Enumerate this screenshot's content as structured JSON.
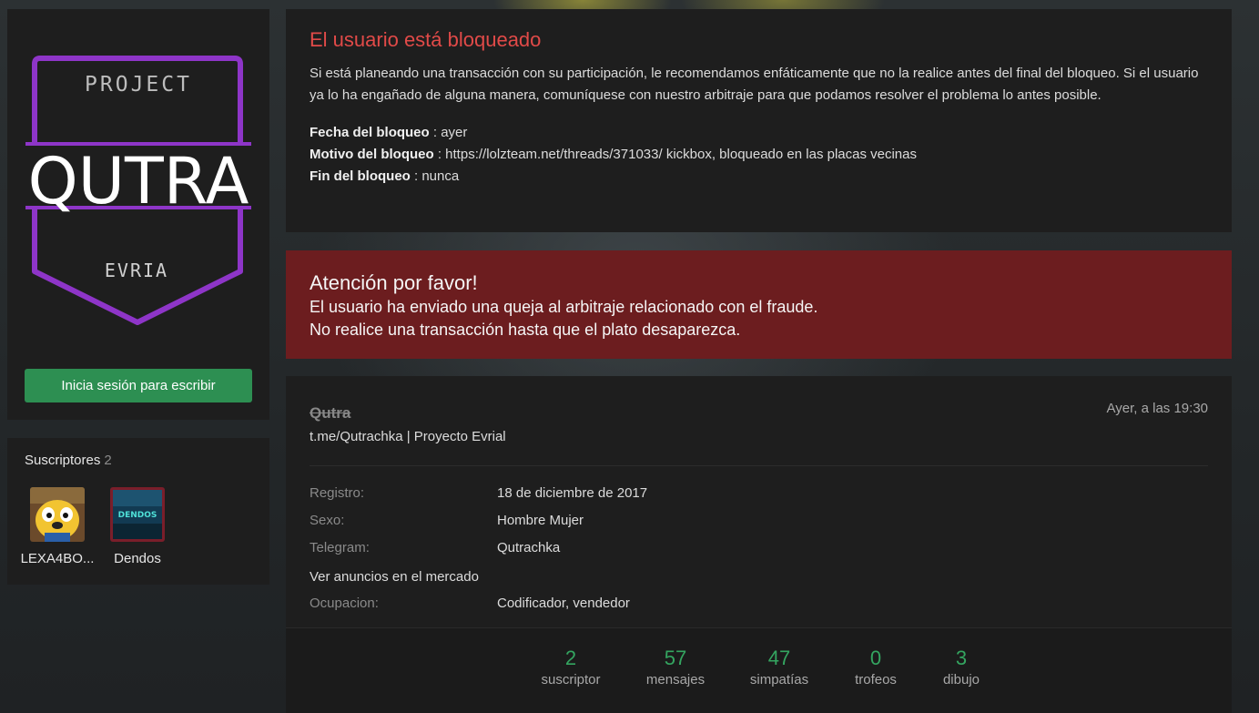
{
  "sidebar": {
    "login_button": "Inicia sesión para escribir",
    "logo": {
      "top_text": "PROJECT",
      "main_text": "QUTRA",
      "bottom_text": "EVRIA",
      "accent_color": "#8e35c8"
    },
    "subscribers": {
      "title": "Suscriptores",
      "count": "2",
      "items": [
        {
          "name": "LEXA4BO...",
          "avatar": "cartoon-dog-avatar"
        },
        {
          "name": "Dendos",
          "avatar": "dendos-avatar"
        }
      ]
    }
  },
  "blocked": {
    "title": "El usuario está bloqueado",
    "description": "Si está planeando una transacción con su participación, le recomendamos enfáticamente que no la realice antes del final del bloqueo. Si el usuario ya lo ha engañado de alguna manera, comuníquese con nuestro arbitraje para que podamos resolver el problema lo antes posible.",
    "date_label": "Fecha del bloqueo",
    "date_value": "ayer",
    "reason_label": "Motivo del bloqueo",
    "reason_value": "https://lolzteam.net/threads/371033/ kickbox, bloqueado en las placas vecinas",
    "end_label": "Fin del bloqueo",
    "end_value": "nunca",
    "title_color": "#e14a48"
  },
  "warning": {
    "title": "Atención por favor!",
    "line1": "El usuario ha enviado una queja al arbitraje relacionado con el fraude.",
    "line2": "No realice una transacción hasta que el plato desaparezca.",
    "background_color": "#6c1d1f"
  },
  "profile": {
    "username": "Qutra",
    "status": "t.me/Qutrachka | Proyecto Evrial",
    "last_seen": "Ayer, a las 19:30",
    "registration_label": "Registro:",
    "registration_value": "18 de diciembre de 2017",
    "gender_label": "Sexo:",
    "gender_value": "Hombre Mujer",
    "telegram_label": "Telegram:",
    "telegram_value": "Qutrachka",
    "market_link": "Ver anuncios en el mercado",
    "occupation_label": "Ocupacion:",
    "occupation_value": "Codificador, vendedor",
    "stats": [
      {
        "value": "2",
        "label": "suscriptor"
      },
      {
        "value": "57",
        "label": "mensajes"
      },
      {
        "value": "47",
        "label": "simpatías"
      },
      {
        "value": "0",
        "label": "trofeos"
      },
      {
        "value": "3",
        "label": "dibujo"
      }
    ],
    "stat_color": "#34a560"
  }
}
